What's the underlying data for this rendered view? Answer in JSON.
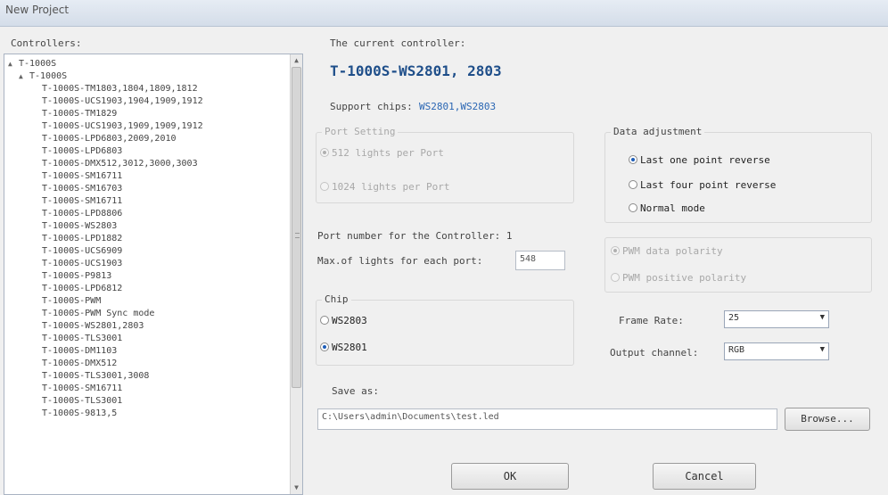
{
  "window": {
    "title": "New Project"
  },
  "controllers": {
    "label": "Controllers:",
    "tree": [
      {
        "level": 0,
        "text": "T-1000S",
        "expander": "▲"
      },
      {
        "level": 1,
        "text": "T-1000S",
        "expander": "▲"
      },
      {
        "level": 2,
        "text": "T-1000S-TM1803,1804,1809,1812"
      },
      {
        "level": 2,
        "text": "T-1000S-UCS1903,1904,1909,1912"
      },
      {
        "level": 2,
        "text": "T-1000S-TM1829"
      },
      {
        "level": 2,
        "text": "T-1000S-UCS1903,1909,1909,1912"
      },
      {
        "level": 2,
        "text": "T-1000S-LPD6803,2009,2010"
      },
      {
        "level": 2,
        "text": "T-1000S-LPD6803"
      },
      {
        "level": 2,
        "text": "T-1000S-DMX512,3012,3000,3003"
      },
      {
        "level": 2,
        "text": "T-1000S-SM16711"
      },
      {
        "level": 2,
        "text": "T-1000S-SM16703"
      },
      {
        "level": 2,
        "text": "T-1000S-SM16711"
      },
      {
        "level": 2,
        "text": "T-1000S-LPD8806"
      },
      {
        "level": 2,
        "text": "T-1000S-WS2803"
      },
      {
        "level": 2,
        "text": "T-1000S-LPD1882"
      },
      {
        "level": 2,
        "text": "T-1000S-UCS6909"
      },
      {
        "level": 2,
        "text": "T-1000S-UCS1903"
      },
      {
        "level": 2,
        "text": "T-1000S-P9813"
      },
      {
        "level": 2,
        "text": "T-1000S-LPD6812"
      },
      {
        "level": 2,
        "text": "T-1000S-PWM"
      },
      {
        "level": 2,
        "text": "T-1000S-PWM Sync mode"
      },
      {
        "level": 2,
        "text": "T-1000S-WS2801,2803"
      },
      {
        "level": 2,
        "text": "T-1000S-TLS3001"
      },
      {
        "level": 2,
        "text": "T-1000S-DM1103"
      },
      {
        "level": 2,
        "text": "T-1000S-DMX512"
      },
      {
        "level": 2,
        "text": "T-1000S-TLS3001,3008"
      },
      {
        "level": 2,
        "text": "T-1000S-SM16711"
      },
      {
        "level": 2,
        "text": "T-1000S-TLS3001"
      },
      {
        "level": 2,
        "text": "T-1000S-9813,5"
      }
    ]
  },
  "current": {
    "label": "The current controller:",
    "value": "T-1000S-WS2801, 2803",
    "support_label": "Support chips:",
    "support_value": "WS2801,WS2803"
  },
  "port_setting": {
    "title": "Port Setting",
    "options": [
      {
        "label": "512 lights per Port",
        "selected": true
      },
      {
        "label": "1024 lights per Port",
        "selected": false
      }
    ]
  },
  "data_adjustment": {
    "title": "Data adjustment",
    "options": [
      {
        "label": "Last one point reverse",
        "selected": true
      },
      {
        "label": "Last four point reverse",
        "selected": false
      },
      {
        "label": "Normal mode",
        "selected": false
      }
    ]
  },
  "port_info": {
    "ports_label": "Port number for the Controller: 1",
    "lights_label": "Max.of lights for each port:",
    "lights_value": "548"
  },
  "pwm": {
    "options": [
      {
        "label": "PWM data polarity",
        "selected": true
      },
      {
        "label": "PWM positive polarity",
        "selected": false
      }
    ]
  },
  "chip": {
    "title": "Chip",
    "options": [
      {
        "label": "WS2803",
        "selected": false
      },
      {
        "label": "WS2801",
        "selected": true
      }
    ]
  },
  "frame_rate": {
    "label": "Frame Rate:",
    "value": "25"
  },
  "output_channel": {
    "label": "Output channel:",
    "value": "RGB"
  },
  "save_as": {
    "label": "Save as:",
    "path": "C:\\Users\\admin\\Documents\\test.led",
    "browse_label": "Browse..."
  },
  "buttons": {
    "ok": "OK",
    "cancel": "Cancel"
  },
  "icons": {
    "expand": "triangle-up-icon",
    "scroll_up": "▲",
    "scroll_down": "▼",
    "combo_arrow": "▼"
  }
}
